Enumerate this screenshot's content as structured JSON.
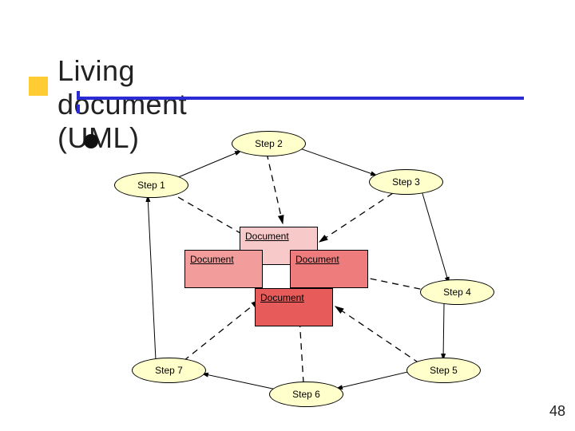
{
  "title": "Living document (UML)",
  "page_number": "48",
  "steps": {
    "s1": "Step 1",
    "s2": "Step 2",
    "s3": "Step 3",
    "s4": "Step 4",
    "s5": "Step 5",
    "s6": "Step 6",
    "s7": "Step 7"
  },
  "docs": {
    "d1": "Document",
    "d2": "Document",
    "d3": "Document",
    "d4": "Document"
  }
}
